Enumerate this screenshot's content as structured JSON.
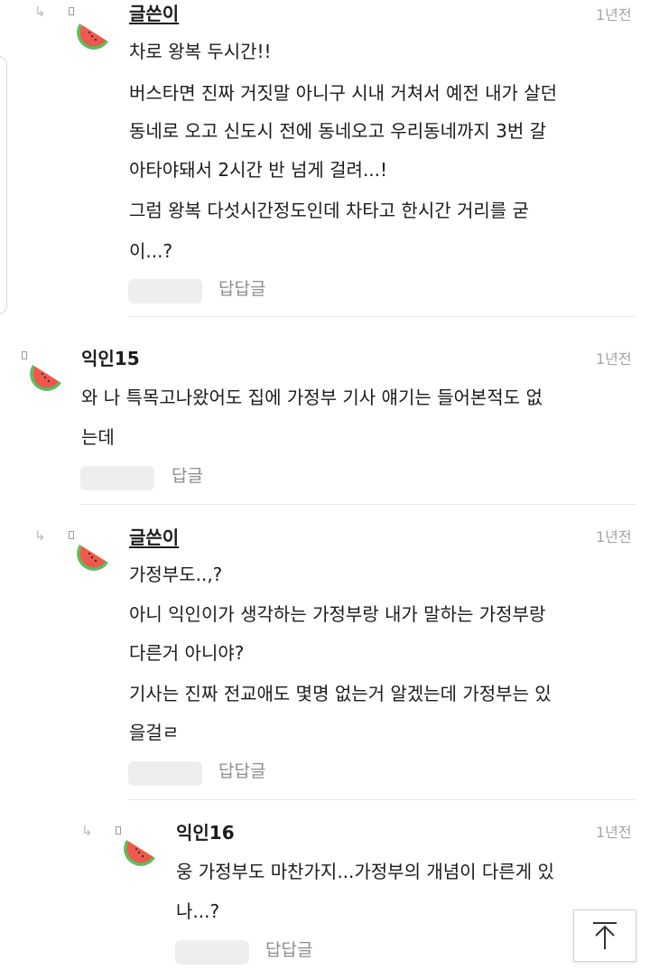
{
  "comments": [
    {
      "author": "글쓴이",
      "time": "1년전",
      "lines": [
        "차로 왕복 두시간!!",
        "버스타면 진짜 거짓말 아니구 시내 거쳐서 예전 내가 살던",
        "동네로 오고 신도시 전에 동네오고 우리동네까지 3번 갈",
        "아타야돼서 2시간 반 넘게 걸려...!",
        "그럼 왕복 다섯시간정도인데 차타고 한시간 거리를 굳",
        "이...?"
      ],
      "reply_label": "답답글"
    },
    {
      "author": "익인15",
      "time": "1년전",
      "lines": [
        "와 나 특목고나왔어도 집에 가정부 기사 얘기는 들어본적도 없",
        "는데"
      ],
      "reply_label": "답글"
    },
    {
      "author": "글쓴이",
      "time": "1년전",
      "lines": [
        "가정부도..,?",
        "아니 익인이가 생각하는 가정부랑 내가 말하는 가정부랑",
        "다른거 아니야?",
        "기사는 진짜 전교애도 몇명 없는거 알겠는데 가정부는 있",
        "을걸ㄹ"
      ],
      "reply_label": "답답글"
    },
    {
      "author": "익인16",
      "time": "1년전",
      "lines": [
        "웅 가정부도 마찬가지...가정부의 개념이 다른게 있",
        "나...?"
      ],
      "reply_label": "답답글"
    }
  ],
  "icons": {
    "reply_arrow": "reply-arrow-icon",
    "avatar": "watermelon-avatar-icon",
    "scroll_top": "arrow-up-to-top-icon"
  },
  "colors": {
    "watermelon_red": "#f0584f",
    "watermelon_green": "#5cbf5a",
    "muted_text": "#a5a5a5"
  }
}
